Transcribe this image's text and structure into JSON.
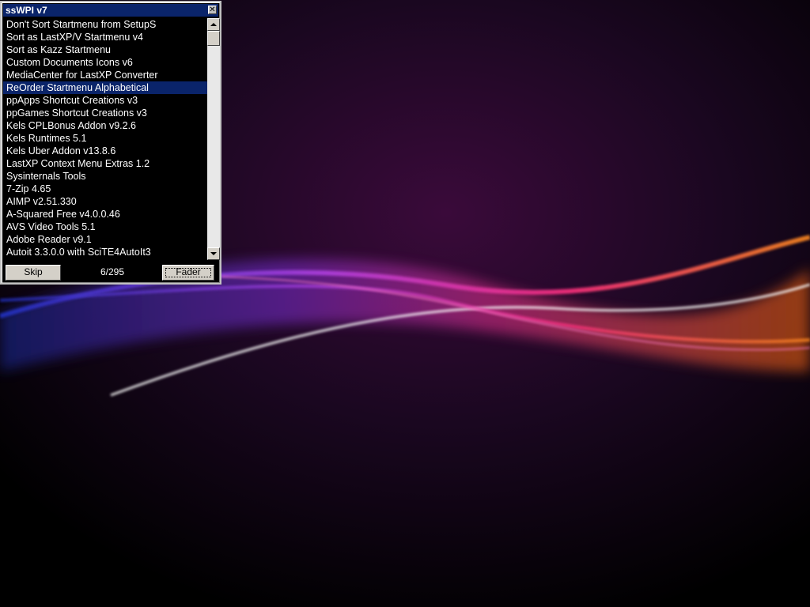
{
  "window": {
    "title": "ssWPI v7",
    "close_glyph": "✕"
  },
  "list": {
    "selected_index": 5,
    "items": [
      "Don't Sort Startmenu from SetupS",
      "Sort as LastXP/V Startmenu v4",
      "Sort as Kazz Startmenu",
      "Custom Documents Icons v6",
      "MediaCenter for LastXP Converter",
      "ReOrder Startmenu Alphabetical",
      "ppApps Shortcut Creations v3",
      "ppGames Shortcut Creations v3",
      "Kels CPLBonus Addon v9.2.6",
      "Kels Runtimes 5.1",
      "Kels Uber Addon v13.8.6",
      "LastXP Context Menu Extras 1.2",
      "Sysinternals Tools",
      "7-Zip 4.65",
      "AIMP v2.51.330",
      "A-Squared Free v4.0.0.46",
      "AVS Video Tools 5.1",
      "Adobe Reader v9.1",
      "Autoit 3.3.0.0 with SciTE4AutoIt3"
    ]
  },
  "controls": {
    "skip_label": "Skip",
    "counter": "6/295",
    "fader_label": "Fader"
  },
  "colors": {
    "selection": "#0a246a",
    "titlebar": "#0a246a",
    "button_face": "#d4d0c8"
  },
  "icons": {
    "close": "close-icon",
    "scroll_up": "scroll-up-arrow-icon",
    "scroll_down": "scroll-down-arrow-icon"
  }
}
